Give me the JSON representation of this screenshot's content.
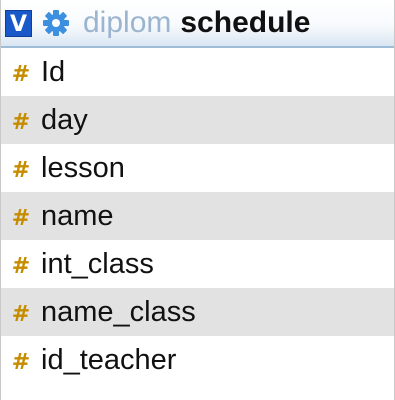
{
  "table": {
    "toggle_label": "V",
    "database": "diplom",
    "name": "schedule",
    "icons": {
      "toggle": "collapse-toggle-icon",
      "options": "gear-icon",
      "column_type": "hash-icon"
    },
    "colors": {
      "toggle": "#1958c9",
      "gear": "#3d8fe0",
      "hash": "#c58c00",
      "database_text": "#9bb4cf"
    },
    "columns": [
      {
        "icon": "#",
        "name": "Id"
      },
      {
        "icon": "#",
        "name": "day"
      },
      {
        "icon": "#",
        "name": "lesson"
      },
      {
        "icon": "#",
        "name": "name"
      },
      {
        "icon": "#",
        "name": "int_class"
      },
      {
        "icon": "#",
        "name": "name_class"
      },
      {
        "icon": "#",
        "name": "id_teacher"
      }
    ]
  }
}
